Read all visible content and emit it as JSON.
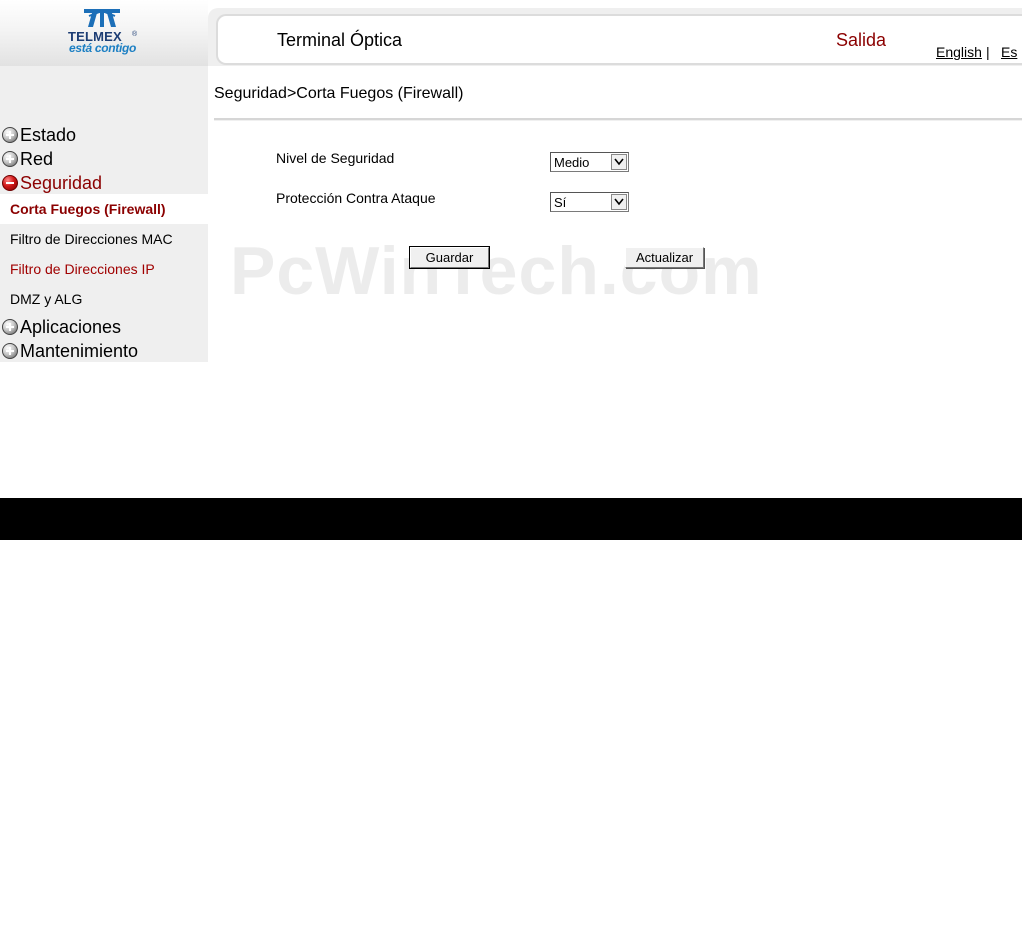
{
  "brand": {
    "name": "TELMEX",
    "registered": "®",
    "tagline": "está contigo"
  },
  "header": {
    "title": "Terminal Óptica",
    "logout": "Salida",
    "lang_english": "English",
    "lang_sep": "|",
    "lang_spanish": "Es"
  },
  "breadcrumb": "Seguridad>Corta Fuegos (Firewall)",
  "sidebar": {
    "items": [
      {
        "label": "Estado",
        "state": "collapsed"
      },
      {
        "label": "Red",
        "state": "collapsed"
      },
      {
        "label": "Seguridad",
        "state": "expanded"
      },
      {
        "label": "Aplicaciones",
        "state": "collapsed"
      },
      {
        "label": "Mantenimiento",
        "state": "collapsed"
      }
    ],
    "subitems": [
      {
        "label": "Corta Fuegos (Firewall)",
        "selected": true
      },
      {
        "label": "Filtro de Direcciones MAC"
      },
      {
        "label": "Filtro de Direcciones IP"
      },
      {
        "label": "DMZ y ALG"
      }
    ]
  },
  "form": {
    "security_level_label": "Nivel de Seguridad",
    "security_level_value": "Medio",
    "attack_protection_label": "Protección Contra Ataque",
    "attack_protection_value": "Sí",
    "save_label": "Guardar",
    "refresh_label": "Actualizar"
  },
  "watermark": "PcWinTech.com",
  "colors": {
    "accent_red": "#8b0000",
    "sidebar_bg": "#efefef",
    "brand_blue": "#1d3d74",
    "band": "#000000"
  }
}
